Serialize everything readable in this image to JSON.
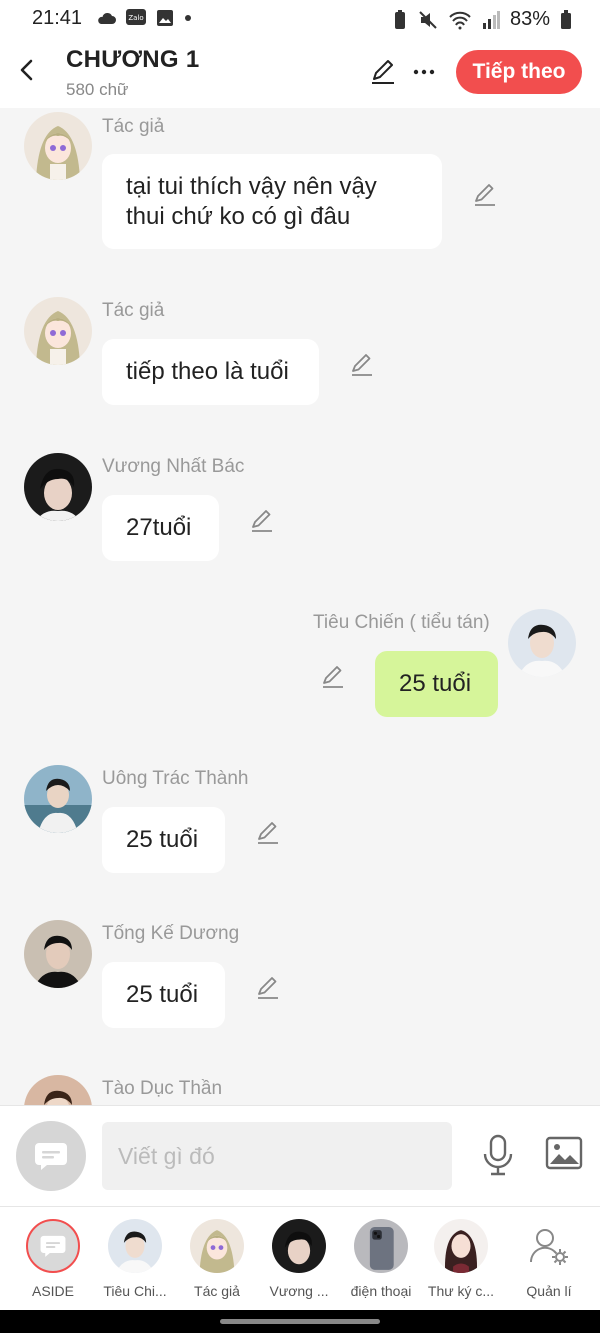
{
  "status": {
    "time": "21:41",
    "battery": "83%"
  },
  "header": {
    "title": "CHƯƠNG 1",
    "subtitle": "580 chữ",
    "next_label": "Tiếp theo"
  },
  "messages": [
    {
      "sender": "Tác giả",
      "text_line1": "tại tui thích vậy nên vậy",
      "text_line2": "thui chứ ko có gì đâu",
      "side": "left",
      "avatar": "anime-girl-avatar"
    },
    {
      "sender": "Tác giả",
      "text": "tiếp theo là tuổi",
      "side": "left",
      "avatar": "anime-girl-avatar"
    },
    {
      "sender": "Vương Nhất Bác",
      "text": "27tuổi",
      "side": "left",
      "avatar": "man-photo-avatar"
    },
    {
      "sender": "Tiêu Chiến ( tiểu tán)",
      "text": "25 tuổi",
      "side": "right",
      "avatar": "man-photo-avatar"
    },
    {
      "sender": "Uông Trác Thành",
      "text": "25 tuổi",
      "side": "left",
      "avatar": "man-photo-avatar"
    },
    {
      "sender": "Tống Kế Dương",
      "text": "25 tuổi",
      "side": "left",
      "avatar": "man-photo-avatar"
    },
    {
      "sender": "Tào Dục Thần",
      "side": "left",
      "avatar": "man-photo-avatar"
    }
  ],
  "input": {
    "placeholder": "Viết gì đó"
  },
  "characters": [
    {
      "label": "ASIDE"
    },
    {
      "label": "Tiêu Chi..."
    },
    {
      "label": "Tác giả"
    },
    {
      "label": "Vương ..."
    },
    {
      "label": "điện thoại"
    },
    {
      "label": "Thư ký c..."
    },
    {
      "label": "Quản lí"
    }
  ],
  "colors": {
    "accent": "#f24e4e",
    "own_bubble": "#d6f59a",
    "background": "#f5f5f5"
  }
}
